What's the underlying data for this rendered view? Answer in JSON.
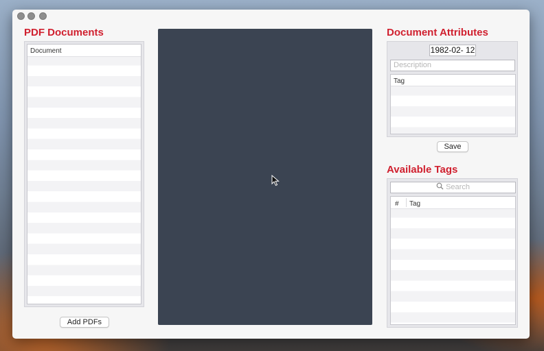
{
  "documents_panel": {
    "title": "PDF Documents",
    "column_header": "Document",
    "add_button_label": "Add PDFs"
  },
  "attributes_panel": {
    "title": "Document Attributes",
    "date_value": "1982-02- 12",
    "description_placeholder": "Description",
    "tag_column_header": "Tag",
    "save_button_label": "Save"
  },
  "tags_panel": {
    "title": "Available Tags",
    "search_placeholder": "Search",
    "columns": [
      "#",
      "Tag"
    ]
  },
  "icons": {
    "search": "search-icon",
    "cursor": "mouse-cursor-icon"
  }
}
